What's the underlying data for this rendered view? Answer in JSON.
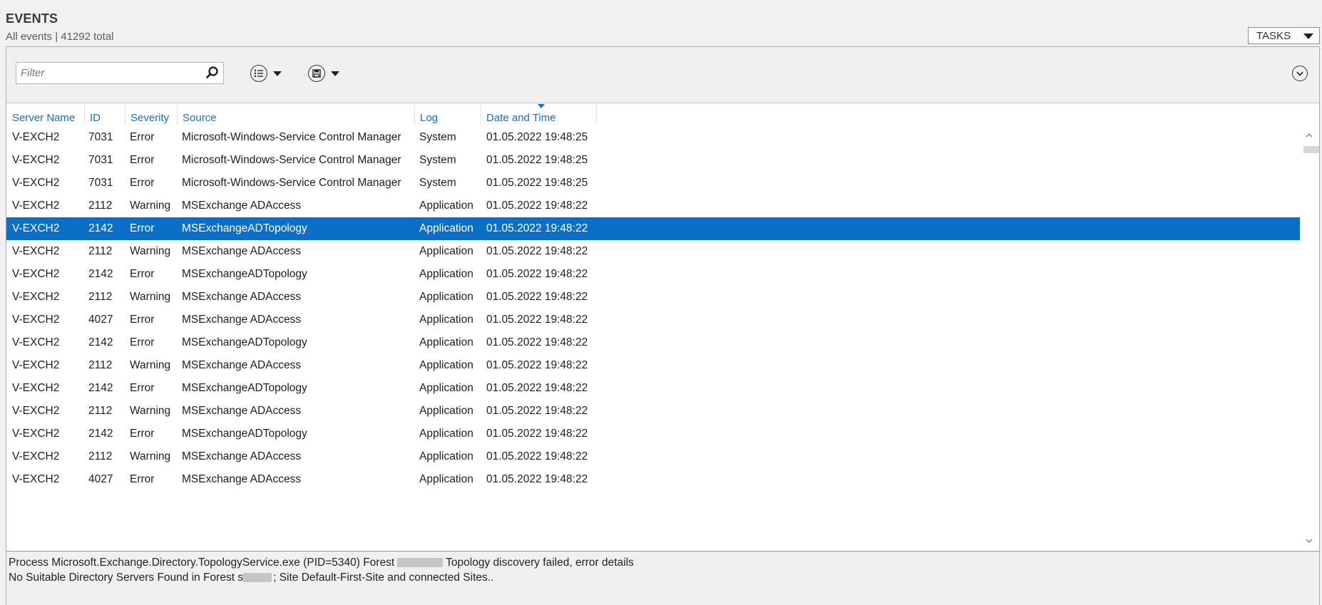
{
  "header": {
    "title": "EVENTS",
    "subtitle": "All events | 41292 total",
    "tasks_label": "TASKS"
  },
  "toolbar": {
    "filter_placeholder": "Filter",
    "icons": [
      "search-icon",
      "list-view-icon",
      "save-icon",
      "expand-icon"
    ]
  },
  "columns": [
    "Server Name",
    "ID",
    "Severity",
    "Source",
    "Log",
    "Date and Time"
  ],
  "rows": [
    {
      "server": "V-EXCH2",
      "id": "7031",
      "severity": "Error",
      "source": "Microsoft-Windows-Service Control Manager",
      "log": "System",
      "datetime": "01.05.2022 19:48:25"
    },
    {
      "server": "V-EXCH2",
      "id": "7031",
      "severity": "Error",
      "source": "Microsoft-Windows-Service Control Manager",
      "log": "System",
      "datetime": "01.05.2022 19:48:25"
    },
    {
      "server": "V-EXCH2",
      "id": "7031",
      "severity": "Error",
      "source": "Microsoft-Windows-Service Control Manager",
      "log": "System",
      "datetime": "01.05.2022 19:48:25"
    },
    {
      "server": "V-EXCH2",
      "id": "2112",
      "severity": "Warning",
      "source": "MSExchange ADAccess",
      "log": "Application",
      "datetime": "01.05.2022 19:48:22"
    },
    {
      "server": "V-EXCH2",
      "id": "2142",
      "severity": "Error",
      "source": "MSExchangeADTopology",
      "log": "Application",
      "datetime": "01.05.2022 19:48:22",
      "selected": true
    },
    {
      "server": "V-EXCH2",
      "id": "2112",
      "severity": "Warning",
      "source": "MSExchange ADAccess",
      "log": "Application",
      "datetime": "01.05.2022 19:48:22"
    },
    {
      "server": "V-EXCH2",
      "id": "2142",
      "severity": "Error",
      "source": "MSExchangeADTopology",
      "log": "Application",
      "datetime": "01.05.2022 19:48:22"
    },
    {
      "server": "V-EXCH2",
      "id": "2112",
      "severity": "Warning",
      "source": "MSExchange ADAccess",
      "log": "Application",
      "datetime": "01.05.2022 19:48:22"
    },
    {
      "server": "V-EXCH2",
      "id": "4027",
      "severity": "Error",
      "source": "MSExchange ADAccess",
      "log": "Application",
      "datetime": "01.05.2022 19:48:22"
    },
    {
      "server": "V-EXCH2",
      "id": "2142",
      "severity": "Error",
      "source": "MSExchangeADTopology",
      "log": "Application",
      "datetime": "01.05.2022 19:48:22"
    },
    {
      "server": "V-EXCH2",
      "id": "2112",
      "severity": "Warning",
      "source": "MSExchange ADAccess",
      "log": "Application",
      "datetime": "01.05.2022 19:48:22"
    },
    {
      "server": "V-EXCH2",
      "id": "2142",
      "severity": "Error",
      "source": "MSExchangeADTopology",
      "log": "Application",
      "datetime": "01.05.2022 19:48:22"
    },
    {
      "server": "V-EXCH2",
      "id": "2112",
      "severity": "Warning",
      "source": "MSExchange ADAccess",
      "log": "Application",
      "datetime": "01.05.2022 19:48:22"
    },
    {
      "server": "V-EXCH2",
      "id": "2142",
      "severity": "Error",
      "source": "MSExchangeADTopology",
      "log": "Application",
      "datetime": "01.05.2022 19:48:22"
    },
    {
      "server": "V-EXCH2",
      "id": "2112",
      "severity": "Warning",
      "source": "MSExchange ADAccess",
      "log": "Application",
      "datetime": "01.05.2022 19:48:22"
    },
    {
      "server": "V-EXCH2",
      "id": "4027",
      "severity": "Error",
      "source": "MSExchange ADAccess",
      "log": "Application",
      "datetime": "01.05.2022 19:48:22"
    }
  ],
  "details": {
    "line1_prefix": "Process Microsoft.Exchange.Directory.TopologyService.exe (PID=5340) Forest",
    "line1_suffix": "Topology discovery failed, error details",
    "line2_prefix": "No Suitable Directory Servers Found in Forest s",
    "line2_suffix": "; Site Default-First-Site and connected Sites.."
  },
  "colors": {
    "accent": "#1a6fc0",
    "selection": "#0b6fc7"
  }
}
